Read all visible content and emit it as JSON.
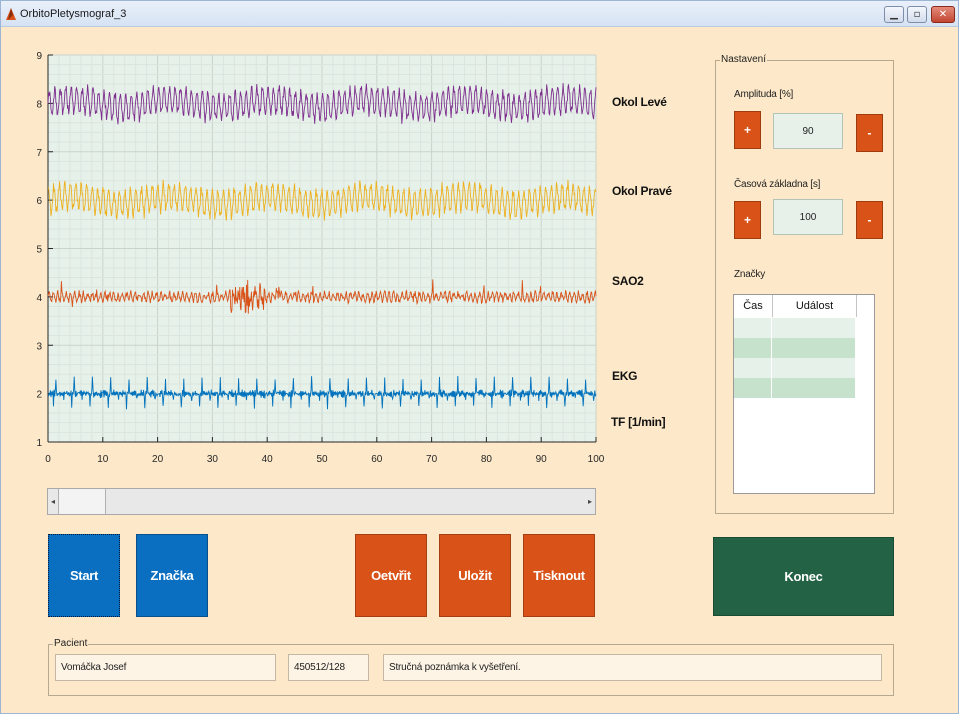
{
  "window": {
    "title": "OrbitoPletysmograf_3"
  },
  "window_controls": {
    "minimize": "▁",
    "maximize": "▫",
    "close": "✕"
  },
  "chart_data": {
    "type": "line",
    "x_ticks": [
      "0",
      "10",
      "20",
      "30",
      "40",
      "50",
      "60",
      "70",
      "80",
      "90",
      "100"
    ],
    "y_ticks": [
      "1",
      "2",
      "3",
      "4",
      "5",
      "6",
      "7",
      "8",
      "9"
    ],
    "xlim": [
      0,
      100
    ],
    "ylim": [
      1,
      9
    ],
    "grid": true,
    "series": [
      {
        "name": "Okol Levé",
        "baseline": 8,
        "color": "#7e2f8e"
      },
      {
        "name": "Okol Pravé",
        "baseline": 6,
        "color": "#edb120"
      },
      {
        "name": "SAO2",
        "baseline": 4,
        "color": "#d95319"
      },
      {
        "name": "EKG",
        "baseline": 2,
        "color": "#0072bd"
      }
    ],
    "extra_label": "TF [1/min]"
  },
  "buttons": {
    "start": "Start",
    "mark": "Značka",
    "open": "Oetvřit",
    "save": "Uložit",
    "print": "Tisknout",
    "end": "Konec"
  },
  "settings": {
    "legend": "Nastavení",
    "amplitude_label": "Amplituda [%]",
    "amplitude_value": "90",
    "timebase_label": "Časová základna [s]",
    "timebase_value": "100",
    "plus": "+",
    "minus": "-",
    "marks_label": "Značky",
    "table_headers": [
      "Čas",
      "Událost"
    ]
  },
  "patient": {
    "legend": "Pacient",
    "name": "Vomáčka Josef",
    "id": "450512/128",
    "note": "Stručná poznámka k vyšetření."
  },
  "colors": {
    "background": "#fde9c9",
    "plot_bg": "#e6f1ea",
    "blue": "#0a6fc0",
    "orange": "#d95319",
    "green": "#246245"
  }
}
